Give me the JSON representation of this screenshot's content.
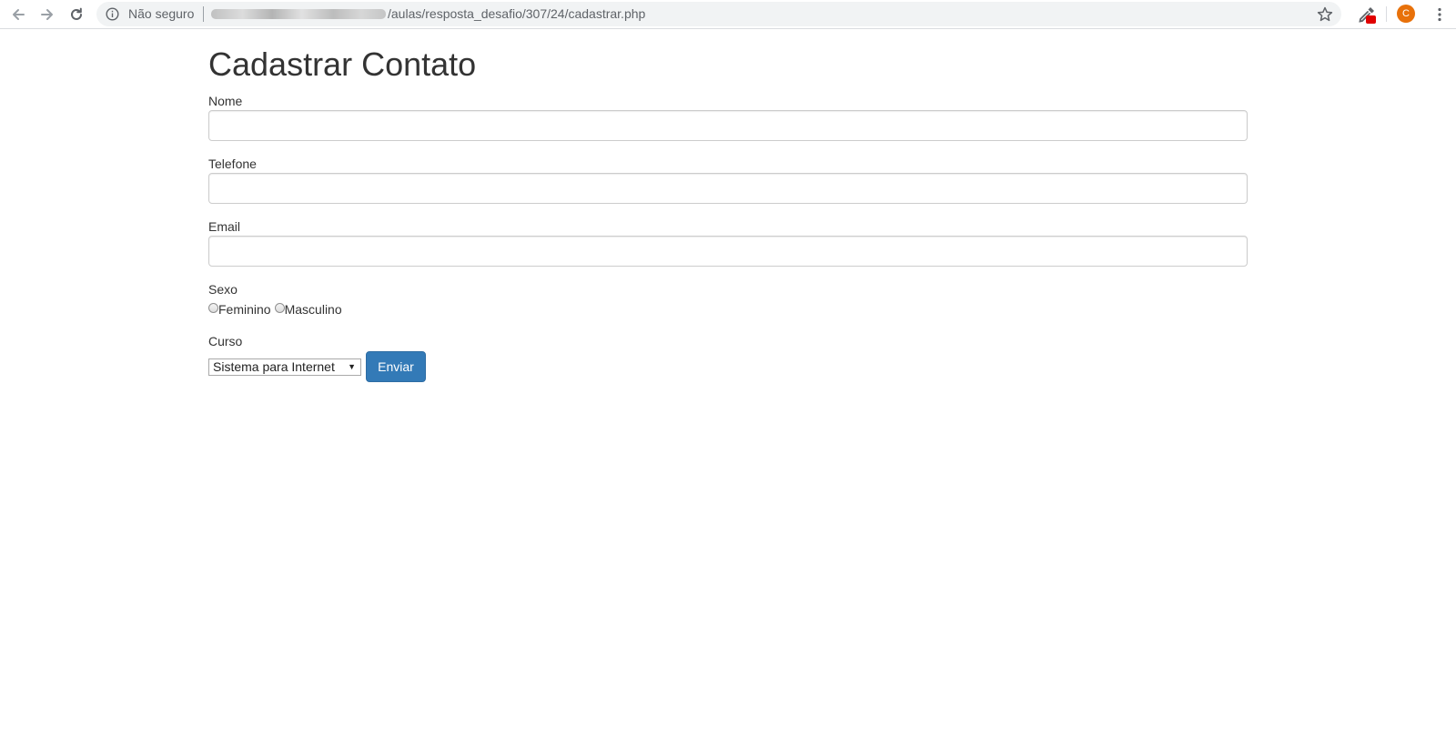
{
  "browser": {
    "security_text": "Não seguro",
    "url_visible": "/aulas/resposta_desafio/307/24/cadastrar.php",
    "profile_initial": "C"
  },
  "page": {
    "title": "Cadastrar Contato",
    "fields": {
      "nome": {
        "label": "Nome",
        "value": ""
      },
      "telefone": {
        "label": "Telefone",
        "value": ""
      },
      "email": {
        "label": "Email",
        "value": ""
      }
    },
    "sexo": {
      "label": "Sexo",
      "options": [
        "Feminino",
        "Masculino"
      ]
    },
    "curso": {
      "label": "Curso",
      "selected": "Sistema para Internet"
    },
    "submit_label": "Enviar"
  },
  "colors": {
    "primary_button": "#337ab7",
    "avatar": "#e8710a",
    "extension_badge": "#e00000"
  }
}
